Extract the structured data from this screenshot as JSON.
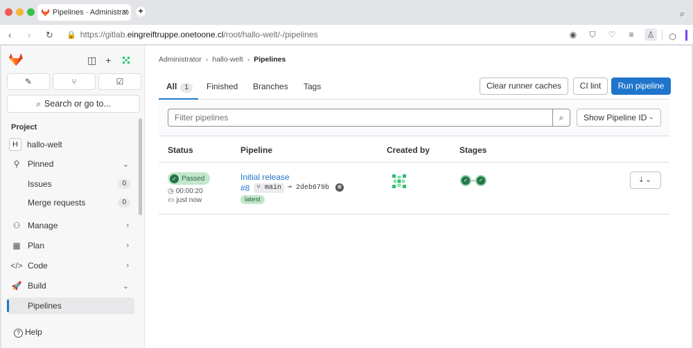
{
  "browser": {
    "tab_title": "Pipelines · Administrator",
    "tab_close": "×",
    "new_tab": "+",
    "url_prefix": "https://gitlab.",
    "url_host": "eingreiftruppe.onetoone.cl",
    "url_path": "/root/hallo-welt/-/pipelines"
  },
  "sidebar": {
    "search_label": "Search or go to...",
    "section_title": "Project",
    "project": {
      "initial": "H",
      "name": "hallo-welt"
    },
    "items": [
      {
        "label": "Pinned",
        "icon": "pin-icon"
      },
      {
        "label": "Issues",
        "count": "0"
      },
      {
        "label": "Merge requests",
        "count": "0"
      },
      {
        "label": "Manage",
        "icon": "users-icon"
      },
      {
        "label": "Plan",
        "icon": "calendar-icon"
      },
      {
        "label": "Code",
        "icon": "code-icon"
      },
      {
        "label": "Build",
        "icon": "rocket-icon"
      },
      {
        "label": "Pipelines"
      }
    ],
    "help_label": "Help"
  },
  "breadcrumb": [
    "Administrator",
    "hallo-welt",
    "Pipelines"
  ],
  "tabs": [
    {
      "label": "All",
      "count": "1"
    },
    {
      "label": "Finished"
    },
    {
      "label": "Branches"
    },
    {
      "label": "Tags"
    }
  ],
  "buttons": {
    "clear_caches": "Clear runner caches",
    "ci_lint": "CI lint",
    "run_pipeline": "Run pipeline"
  },
  "filter": {
    "placeholder": "Filter pipelines",
    "show_id": "Show Pipeline ID"
  },
  "table": {
    "headers": [
      "Status",
      "Pipeline",
      "Created by",
      "Stages"
    ],
    "rows": [
      {
        "status": "Passed",
        "duration": "00:00:20",
        "finished": "just now",
        "title": "Initial release",
        "id": "#8",
        "branch": "main",
        "commit": "2deb679b",
        "tag": "latest"
      }
    ]
  },
  "colors": {
    "accent": "#1f75cb",
    "success": "#217645",
    "badge_success_bg": "#c3e6cd"
  }
}
